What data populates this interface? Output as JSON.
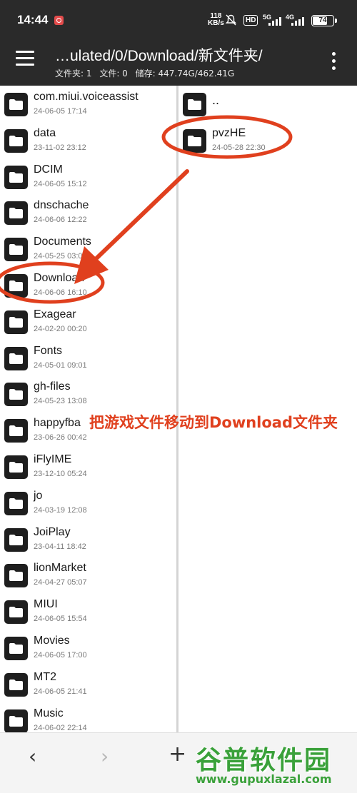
{
  "status_bar": {
    "time": "14:44",
    "net_speed_value": "118",
    "net_speed_unit": "KB/s",
    "hd_badge": "HD",
    "sim1_label": "5G",
    "sim2_label": "4G",
    "battery": "74",
    "battery_level": 0.74
  },
  "app_bar": {
    "path": "…ulated/0/Download/新文件夹/",
    "folders_label": "文件夹: 1",
    "files_label": "文件: 0",
    "storage_label": "储存: 447.74G/462.41G"
  },
  "left_pane": {
    "items": [
      {
        "name": "com.miui.voiceassist",
        "date": "24-06-05 17:14"
      },
      {
        "name": "data",
        "date": "23-11-02 23:12"
      },
      {
        "name": "DCIM",
        "date": "24-06-05 15:12"
      },
      {
        "name": "dnschache",
        "date": "24-06-06 12:22"
      },
      {
        "name": "Documents",
        "date": "24-05-25 03:09"
      },
      {
        "name": "Download",
        "date": "24-06-06 16:10"
      },
      {
        "name": "Exagear",
        "date": "24-02-20 00:20"
      },
      {
        "name": "Fonts",
        "date": "24-05-01 09:01"
      },
      {
        "name": "gh-files",
        "date": "24-05-23 13:08"
      },
      {
        "name": "happyfba",
        "date": "23-06-26 00:42"
      },
      {
        "name": "iFlyIME",
        "date": "23-12-10 05:24"
      },
      {
        "name": "jo",
        "date": "24-03-19 12:08"
      },
      {
        "name": "JoiPlay",
        "date": "23-04-11 18:42"
      },
      {
        "name": "lionMarket",
        "date": "24-04-27 05:07"
      },
      {
        "name": "MIUI",
        "date": "24-06-05 15:54"
      },
      {
        "name": "Movies",
        "date": "24-06-05 17:00"
      },
      {
        "name": "MT2",
        "date": "24-06-05 21:41"
      },
      {
        "name": "Music",
        "date": "24-06-02 22:14"
      }
    ]
  },
  "right_pane": {
    "parent_label": "..",
    "items": [
      {
        "name": "pvzHE",
        "date": "24-05-28 22:30"
      }
    ]
  },
  "annotation": {
    "text": "把游戏文件移动到Download文件夹",
    "color": "#e0401e"
  },
  "bottom_bar": {
    "back": "‹",
    "forward": "›",
    "add": "+"
  },
  "watermark": {
    "brand": "谷普软件园",
    "url": "www.gupuxlazal.com",
    "color": "#3aa13a"
  }
}
